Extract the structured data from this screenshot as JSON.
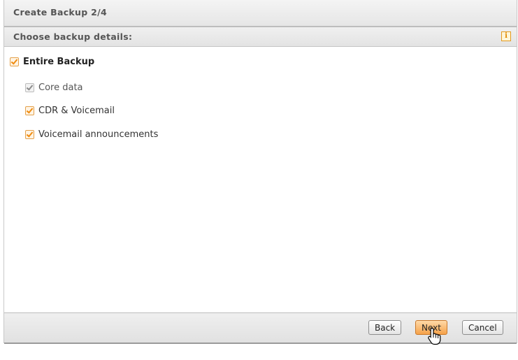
{
  "dialog": {
    "title": "Create Backup 2/4",
    "subtitle": "Choose backup details:",
    "info_icon": "info-icon"
  },
  "options": {
    "entire_backup": {
      "label": "Entire Backup",
      "checked": true
    },
    "core_data": {
      "label": "Core data",
      "checked": true,
      "disabled": true
    },
    "cdr_voicemail": {
      "label": "CDR & Voicemail",
      "checked": true
    },
    "voicemail_announcements": {
      "label": "Voicemail announcements",
      "checked": true
    }
  },
  "buttons": {
    "back": "Back",
    "next": "Next",
    "cancel": "Cancel"
  },
  "colors": {
    "accent": "#f5a24a",
    "check": "#f08c10"
  }
}
